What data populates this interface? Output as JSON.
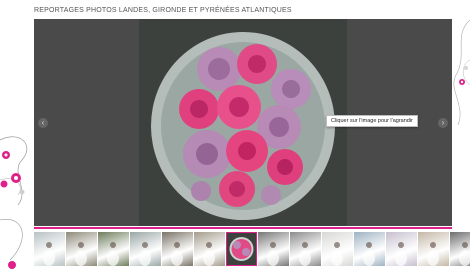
{
  "page": {
    "title": "REPORTAGES PHOTOS LANDES, GIRONDE ET PYRÉNÉES ATLANTIQUES"
  },
  "viewer": {
    "tooltip": "Cliquer sur l'image pour l'agrandir",
    "prev_icon": "‹",
    "next_icon": "›",
    "photo_subject": "bouquet-of-roses"
  },
  "colors": {
    "accent": "#e0208a",
    "viewer_bg": "#4a4a4a"
  },
  "thumbnails": [
    {
      "subject": "bride-outdoor",
      "tone": "#b9c2c4"
    },
    {
      "subject": "bride-crowd",
      "tone": "#8e8a7a"
    },
    {
      "subject": "couple-garden",
      "tone": "#6f7d5d"
    },
    {
      "subject": "park-trees",
      "tone": "#9aa7a6"
    },
    {
      "subject": "couple-portrait",
      "tone": "#7a7468"
    },
    {
      "subject": "group-guests",
      "tone": "#a49c8c"
    },
    {
      "subject": "bouquet-of-roses",
      "tone": "#3e423f",
      "selected": true
    },
    {
      "subject": "black-white-couple",
      "tone": "#777777"
    },
    {
      "subject": "dancing-couple",
      "tone": "#8c8c8c"
    },
    {
      "subject": "white-dress",
      "tone": "#d8d8d6"
    },
    {
      "subject": "beach-couple",
      "tone": "#9fb3c3"
    },
    {
      "subject": "purple-flowers",
      "tone": "#c7c0cf"
    },
    {
      "subject": "wedding-rings",
      "tone": "#c4b8a6"
    },
    {
      "subject": "black-white-portrait",
      "tone": "#6e6e6e"
    }
  ]
}
